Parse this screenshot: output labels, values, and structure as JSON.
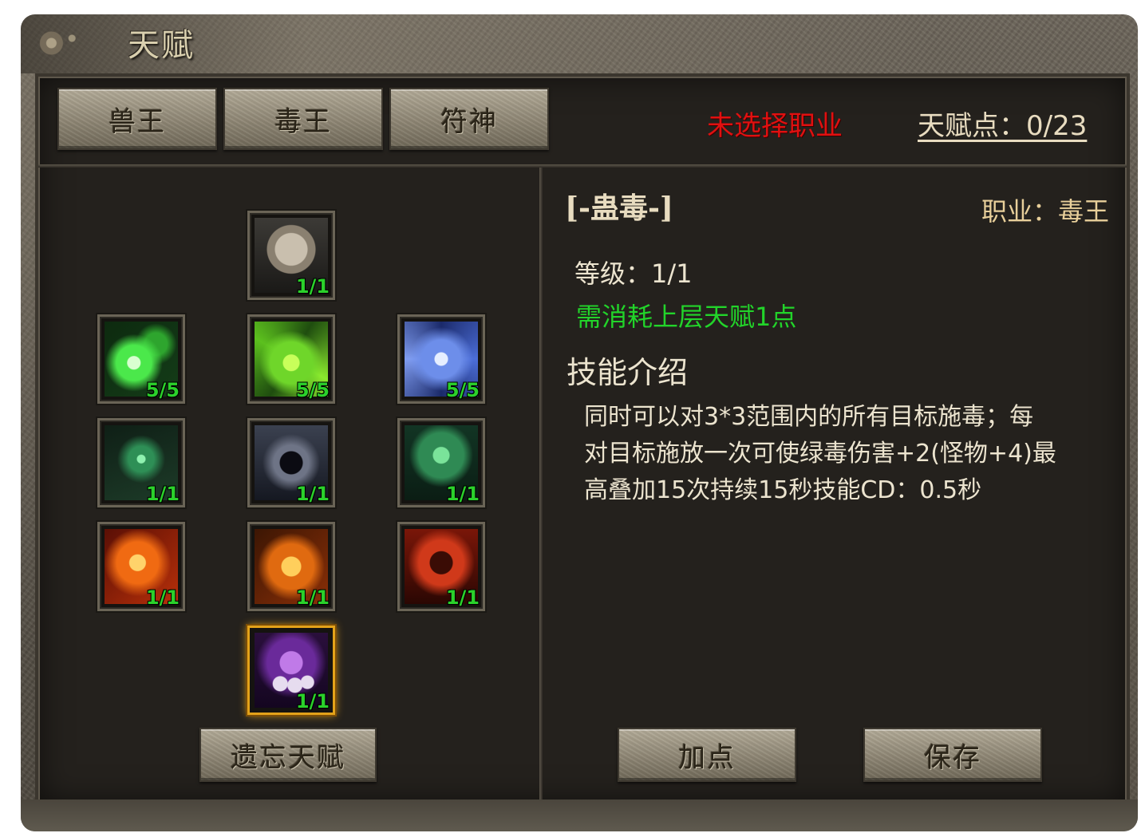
{
  "window": {
    "title": "天赋"
  },
  "tabs": [
    {
      "label": "兽王"
    },
    {
      "label": "毒王"
    },
    {
      "label": "符神"
    }
  ],
  "header": {
    "status": "未选择职业",
    "talent_points": "天赋点：0/23"
  },
  "skills": [
    {
      "icon": "skull-icon",
      "level": "1/1"
    },
    {
      "icon": "green-poison-spirit-icon",
      "level": "5/5"
    },
    {
      "icon": "green-whirl-icon",
      "level": "5/5"
    },
    {
      "icon": "blue-vortex-icon",
      "level": "5/5"
    },
    {
      "icon": "green-serpent-icon",
      "level": "1/1"
    },
    {
      "icon": "dark-wraith-icon",
      "level": "1/1"
    },
    {
      "icon": "green-tree-icon",
      "level": "1/1"
    },
    {
      "icon": "fire-seal-icon",
      "level": "1/1"
    },
    {
      "icon": "fire-defense-rune-icon",
      "level": "1/1"
    },
    {
      "icon": "fire-demon-icon",
      "level": "1/1"
    },
    {
      "icon": "purple-skulls-icon",
      "level": "1/1"
    }
  ],
  "forget_button": "遗忘天赋",
  "detail": {
    "skill_name": "[-蛊毒-]",
    "job": "职业：毒王",
    "level": "等级：1/1",
    "requirement": "需消耗上层天赋1点",
    "intro_title": "技能介绍",
    "description_lines": [
      "同时可以对3*3范围内的所有目标施毒；每",
      "对目标施放一次可使绿毒伤害+2(怪物+4)最",
      "高叠加15次持续15秒技能CD：0.5秒"
    ]
  },
  "buttons": {
    "add_point": "加点",
    "save": "保存"
  },
  "colors": {
    "status_red": "#e01010",
    "requirement_green": "#22d42a",
    "level_green": "#2bd12b",
    "selected_border": "#e3a21a"
  }
}
